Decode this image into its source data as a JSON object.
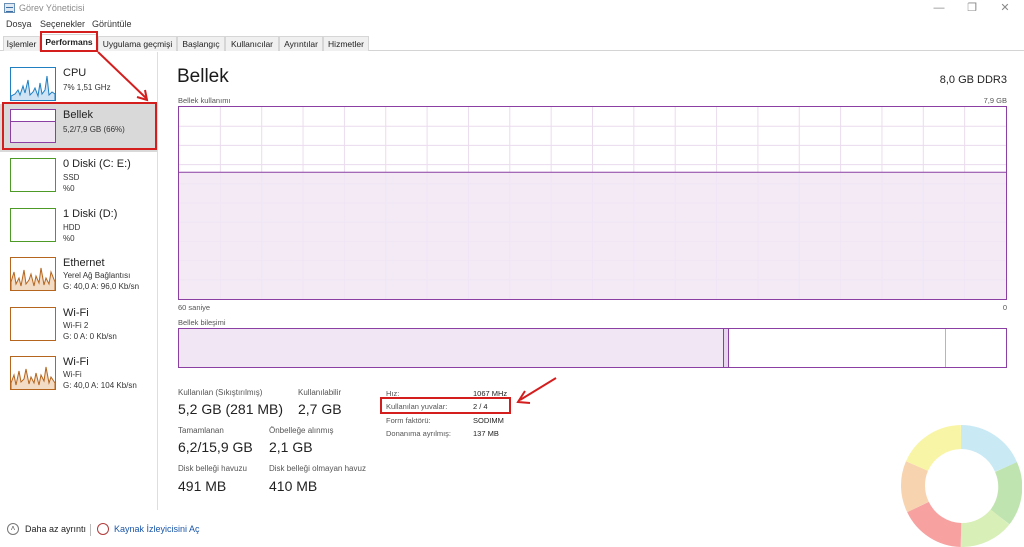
{
  "window": {
    "title": "Görev Yöneticisi"
  },
  "menu": [
    "Dosya",
    "Seçenekler",
    "Görüntüle"
  ],
  "tabs": [
    "İşlemler",
    "Performans",
    "Uygulama geçmişi",
    "Başlangıç",
    "Kullanıcılar",
    "Ayrıntılar",
    "Hizmetler"
  ],
  "active_tab": "Performans",
  "sidebar": {
    "items": [
      {
        "title": "CPU",
        "sub1": "7% 1,51 GHz",
        "sub2": "",
        "color": "#1f7fc1"
      },
      {
        "title": "Bellek",
        "sub1": "5,2/7,9 GB (66%)",
        "sub2": "",
        "color": "#8b3fa2"
      },
      {
        "title": "0 Diski (C: E:)",
        "sub1": "SSD",
        "sub2": "%0",
        "color": "#4d9a26"
      },
      {
        "title": "1 Diski (D:)",
        "sub1": "HDD",
        "sub2": "%0",
        "color": "#4d9a26"
      },
      {
        "title": "Ethernet",
        "sub1": "Yerel Ağ Bağlantısı",
        "sub2": "G: 40,0  A: 96,0 Kb/sn",
        "color": "#b5651d"
      },
      {
        "title": "Wi-Fi",
        "sub1": "Wi-Fi 2",
        "sub2": "G: 0  A: 0 Kb/sn",
        "color": "#b5651d"
      },
      {
        "title": "Wi-Fi",
        "sub1": "Wi-Fi",
        "sub2": "G: 40,0  A: 104 Kb/sn",
        "color": "#b5651d"
      }
    ]
  },
  "main": {
    "title": "Bellek",
    "capacity": "8,0 GB DDR3",
    "usage_label": "Bellek kullanımı",
    "usage_max": "7,9 GB",
    "axis_left": "60 saniye",
    "axis_right": "0",
    "composition_label": "Bellek bileşimi",
    "usage_level": 0.66
  },
  "stats": {
    "in_use_label": "Kullanılan (Sıkıştırılmış)",
    "in_use_value": "5,2 GB (281 MB)",
    "available_label": "Kullanılabilir",
    "available_value": "2,7 GB",
    "committed_label": "Tamamlanan",
    "committed_value": "6,2/15,9 GB",
    "cached_label": "Önbelleğe alınmış",
    "cached_value": "2,1 GB",
    "paged_label": "Disk belleği havuzu",
    "paged_value": "491 MB",
    "nonpaged_label": "Disk belleği olmayan havuz",
    "nonpaged_value": "410 MB"
  },
  "details": {
    "speed_label": "Hız:",
    "speed_value": "1067 MHz",
    "slots_label": "Kullanılan yuvalar:",
    "slots_value": "2 / 4",
    "form_label": "Form faktörü:",
    "form_value": "SODIMM",
    "reserved_label": "Donanıma ayrılmış:",
    "reserved_value": "137 MB"
  },
  "footer": {
    "fewer_details": "Daha az ayrıntı",
    "resource_monitor": "Kaynak İzleyicisini Aç"
  },
  "colors": {
    "memory_accent": "#8b3fa2",
    "annotation_red": "#d41e1e"
  }
}
